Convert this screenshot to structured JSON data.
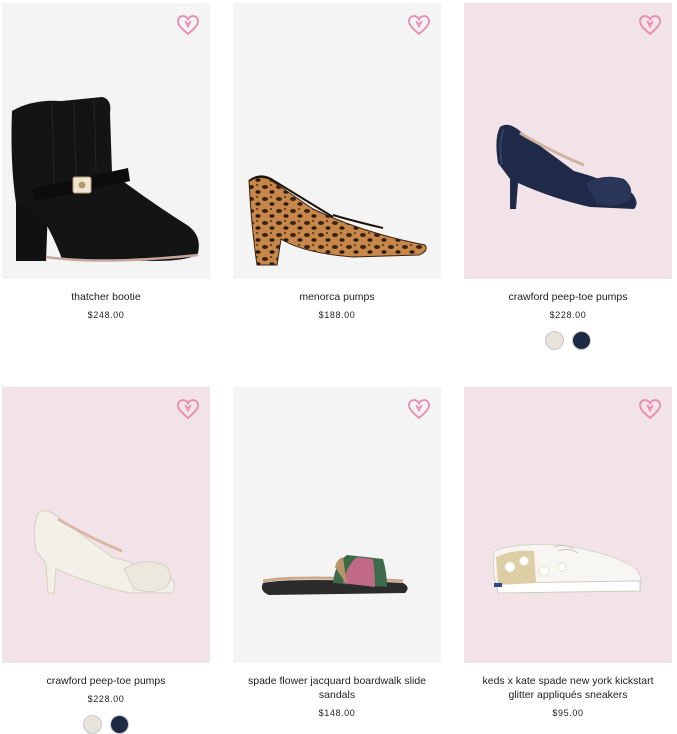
{
  "products": [
    {
      "name": "thatcher bootie",
      "price": "$248.00",
      "background": "#f4f4f4",
      "icon": "heart-icon",
      "swatches": []
    },
    {
      "name": "menorca pumps",
      "price": "$188.00",
      "background": "#f4f4f4",
      "icon": "heart-icon",
      "swatches": []
    },
    {
      "name": "crawford peep-toe pumps",
      "price": "$228.00",
      "background": "#f1e3e7",
      "icon": "heart-icon",
      "swatches": [
        "#e8e4dc",
        "#1d2a44"
      ]
    },
    {
      "name": "crawford peep-toe pumps",
      "price": "$228.00",
      "background": "#f1e3e7",
      "icon": "heart-icon",
      "swatches": [
        "#e8e4dc",
        "#1d2a44"
      ]
    },
    {
      "name": "spade flower jacquard boardwalk slide sandals",
      "price": "$148.00",
      "background": "#f4f4f4",
      "icon": "heart-icon",
      "swatches": []
    },
    {
      "name": "keds x kate spade new york kickstart glitter appliqués sneakers",
      "price": "$95.00",
      "background": "#f1e3e7",
      "icon": "heart-icon",
      "swatches": []
    }
  ],
  "colors": {
    "heart": "#e98bb0",
    "text": "#222222"
  }
}
